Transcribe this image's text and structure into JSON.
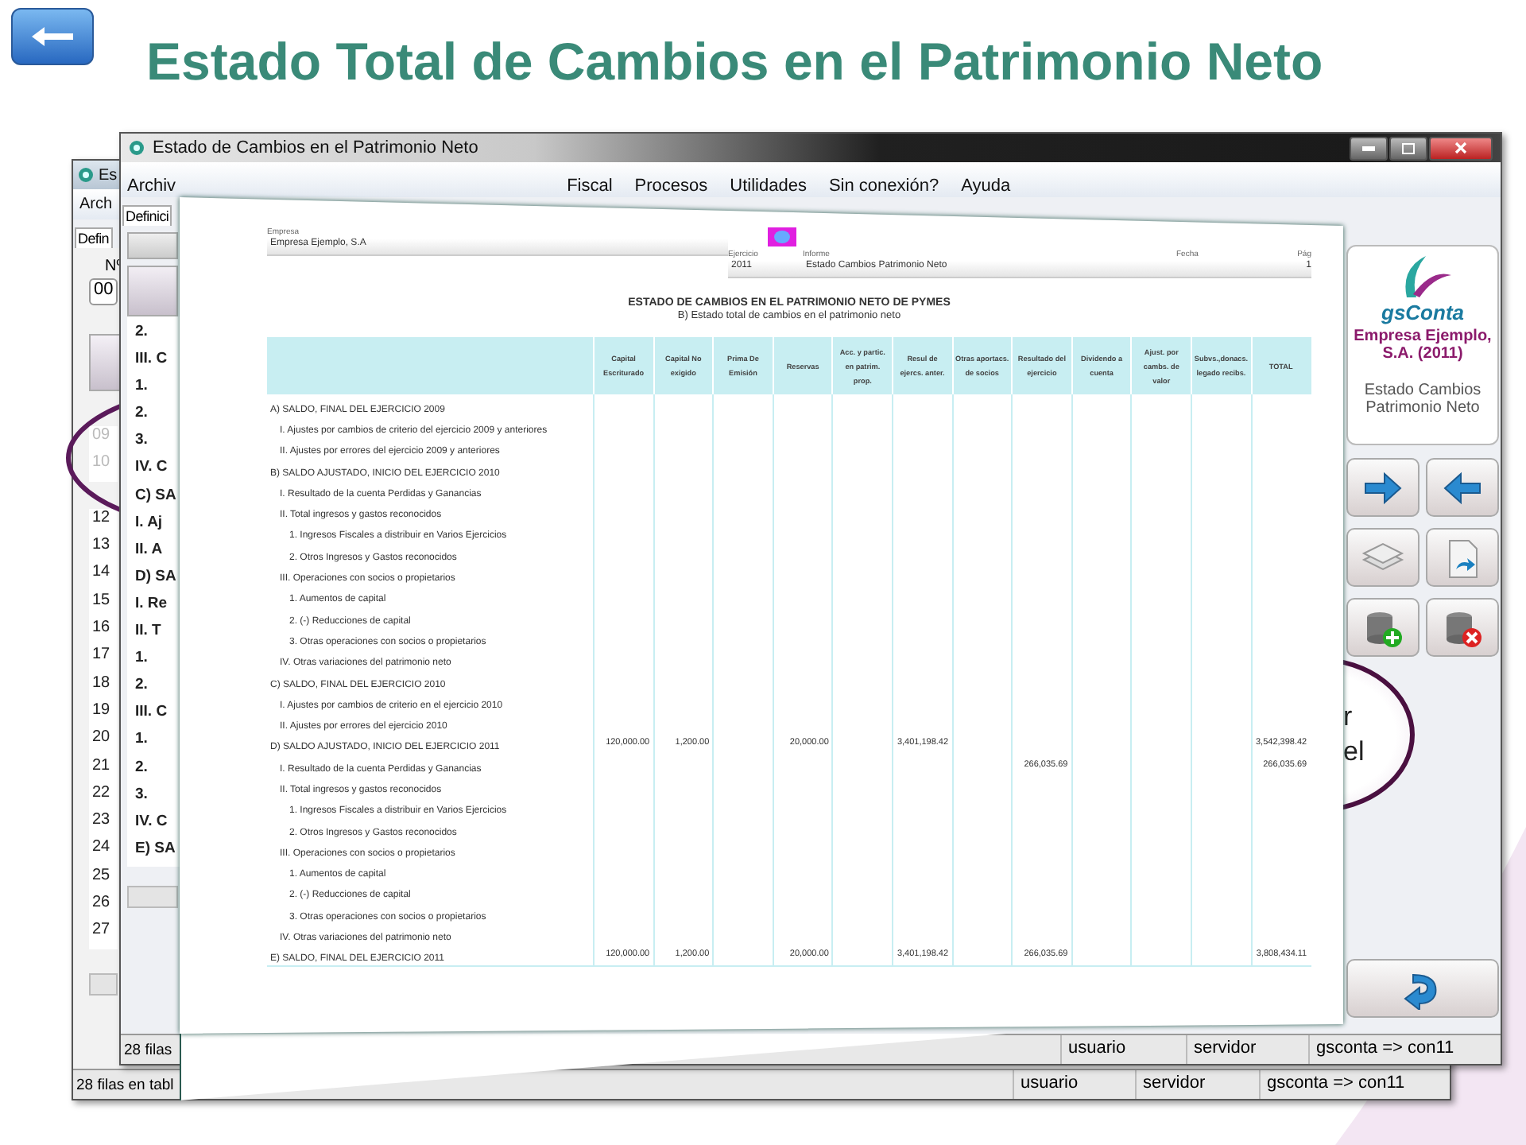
{
  "title": "Estado Total de Cambios en el Patrimonio Neto",
  "back_window": {
    "title": "Es",
    "menu": [
      "Arch"
    ],
    "toolbar": [
      "Defin"
    ],
    "number_label": "Nº",
    "number_value": "00",
    "rows": [
      {
        "number": "09",
        "dimmed": true
      },
      {
        "number": "10",
        "dimmed": true
      },
      {
        "number": "12",
        "dimmed": false
      },
      {
        "number": "13",
        "dimmed": false
      },
      {
        "number": "14",
        "dimmed": false
      },
      {
        "number": "15",
        "dimmed": false
      },
      {
        "number": "16",
        "dimmed": false
      },
      {
        "number": "17",
        "dimmed": false
      },
      {
        "number": "18",
        "dimmed": false
      },
      {
        "number": "19",
        "dimmed": false
      },
      {
        "number": "20",
        "dimmed": false
      },
      {
        "number": "21",
        "dimmed": false
      },
      {
        "number": "22",
        "dimmed": false
      },
      {
        "number": "23",
        "dimmed": false
      },
      {
        "number": "24",
        "dimmed": false
      },
      {
        "number": "25",
        "dimmed": false
      },
      {
        "number": "26",
        "dimmed": false
      },
      {
        "number": "27",
        "dimmed": false
      }
    ],
    "status_bar": [
      "28 filas en tabl",
      "usuario",
      "servidor",
      "gsconta => con11"
    ]
  },
  "main_window": {
    "title": "Estado de Cambios en el Patrimonio Neto",
    "menu": [
      "Archiv",
      "Fiscal",
      "Procesos",
      "Utilidades",
      "Sin conexión?",
      "Ayuda"
    ],
    "toolbar": [
      "Definici"
    ],
    "list": [
      "2.",
      "III. C",
      "1.",
      "2.",
      "3.",
      "IV. C",
      "C) SA",
      "I. Aj",
      "II. A",
      "D) SA",
      "I. Re",
      "II. T",
      "1.",
      "2.",
      "III. C",
      "1.",
      "2.",
      "3.",
      "IV. C",
      "E) SA"
    ],
    "side_panel": {
      "app_name": "gsConta",
      "company": "Empresa Ejemplo, S.A. (2011)",
      "report": "Estado Cambios Patrimonio Neto"
    },
    "status_bar": [
      "28 filas",
      "usuario",
      "servidor",
      "gsconta => con11"
    ]
  },
  "callout": {
    "lines": [
      "r",
      "el"
    ]
  },
  "report": {
    "company_label": "Empresa",
    "company": "Empresa Ejemplo, S.A",
    "year_label": "Ejercicio",
    "year": "2011",
    "report_label": "Informe",
    "report_name": "Estado Cambios Patrimonio Neto",
    "date_label": "Fecha",
    "page_label": "Pág",
    "page": "1",
    "heading": "ESTADO DE CAMBIOS EN EL PATRIMONIO NETO DE PYMES",
    "subheading": "B) Estado total de cambios en el patrimonio neto",
    "columns": [
      {
        "lines": [
          "Capital",
          "Escriturado"
        ]
      },
      {
        "lines": [
          "Capital",
          "No exigido"
        ]
      },
      {
        "lines": [
          "Prima",
          "De Emisión"
        ]
      },
      {
        "lines": [
          "Reservas"
        ]
      },
      {
        "lines": [
          "Acc. y partic. en",
          "patrim. prop."
        ]
      },
      {
        "lines": [
          "Resul de",
          "ejercs. anter."
        ]
      },
      {
        "lines": [
          "Otras aportacs.",
          "de socios"
        ]
      },
      {
        "lines": [
          "Resultado",
          "del ejercicio"
        ]
      },
      {
        "lines": [
          "Dividendo",
          "a cuenta"
        ]
      },
      {
        "lines": [
          "Ajust. por",
          "cambs. de valor"
        ]
      },
      {
        "lines": [
          "Subvs.,donacs.",
          "legado recibs."
        ]
      },
      {
        "lines": [
          "TOTAL"
        ]
      }
    ],
    "rows": [
      {
        "label": "A) SALDO, FINAL DEL EJERCICIO 2009",
        "children": [
          {
            "label": "I. Ajustes por cambios de criterio del ejercicio 2009 y anteriores"
          },
          {
            "label": "II. Ajustes por errores del ejercicio 2009 y anteriores"
          }
        ]
      },
      {
        "label": "B) SALDO AJUSTADO, INICIO DEL EJERCICIO 2010",
        "children": [
          {
            "label": "I. Resultado de la cuenta Perdidas y Ganancias"
          },
          {
            "label": "II. Total ingresos y gastos reconocidos",
            "children": [
              {
                "label": "1. Ingresos Fiscales a distribuir en Varios Ejercicios"
              },
              {
                "label": "2. Otros Ingresos y Gastos reconocidos"
              }
            ]
          },
          {
            "label": "III. Operaciones con socios o propietarios",
            "children": [
              {
                "label": "1. Aumentos de capital"
              },
              {
                "label": "2. (-) Reducciones de capital"
              },
              {
                "label": "3. Otras operaciones con socios o propietarios"
              }
            ]
          },
          {
            "label": "IV. Otras variaciones del patrimonio neto"
          }
        ]
      },
      {
        "label": "C) SALDO, FINAL DEL EJERCICIO 2010",
        "children": [
          {
            "label": "I. Ajustes por cambios de criterio en el ejercicio 2010"
          },
          {
            "label": "II. Ajustes por errores del ejercicio 2010"
          }
        ]
      },
      {
        "label": "D) SALDO AJUSTADO, INICIO DEL EJERCICIO 2011",
        "capital_escriturado": "120,000.00",
        "capital_no_exigido": "1,200.00",
        "reservas": "20,000.00",
        "resultados_anteriores": "3,401,198.42",
        "total": "3,542,398.42",
        "children": [
          {
            "label": "I. Resultado de la cuenta Perdidas y Ganancias",
            "resultado_del_ejercicio": "266,035.69",
            "total": "266,035.69"
          },
          {
            "label": "II. Total ingresos y gastos reconocidos",
            "children": [
              {
                "label": "1. Ingresos Fiscales a distribuir en Varios Ejercicios"
              },
              {
                "label": "2. Otros Ingresos y Gastos reconocidos"
              }
            ]
          },
          {
            "label": "III. Operaciones con socios o propietarios",
            "children": [
              {
                "label": "1. Aumentos de capital"
              },
              {
                "label": "2. (-) Reducciones de capital"
              },
              {
                "label": "3. Otras operaciones con socios o propietarios"
              }
            ]
          },
          {
            "label": "IV. Otras variaciones del patrimonio neto"
          }
        ]
      },
      {
        "label": "E) SALDO, FINAL DEL EJERCICIO 2011",
        "capital_escriturado": "120,000.00",
        "capital_no_exigido": "1,200.00",
        "reservas": "20,000.00",
        "resultados_anteriores": "3,401,198.42",
        "resultado_del_ejercicio": "266,035.69",
        "total": "3,808,434.11"
      }
    ]
  }
}
